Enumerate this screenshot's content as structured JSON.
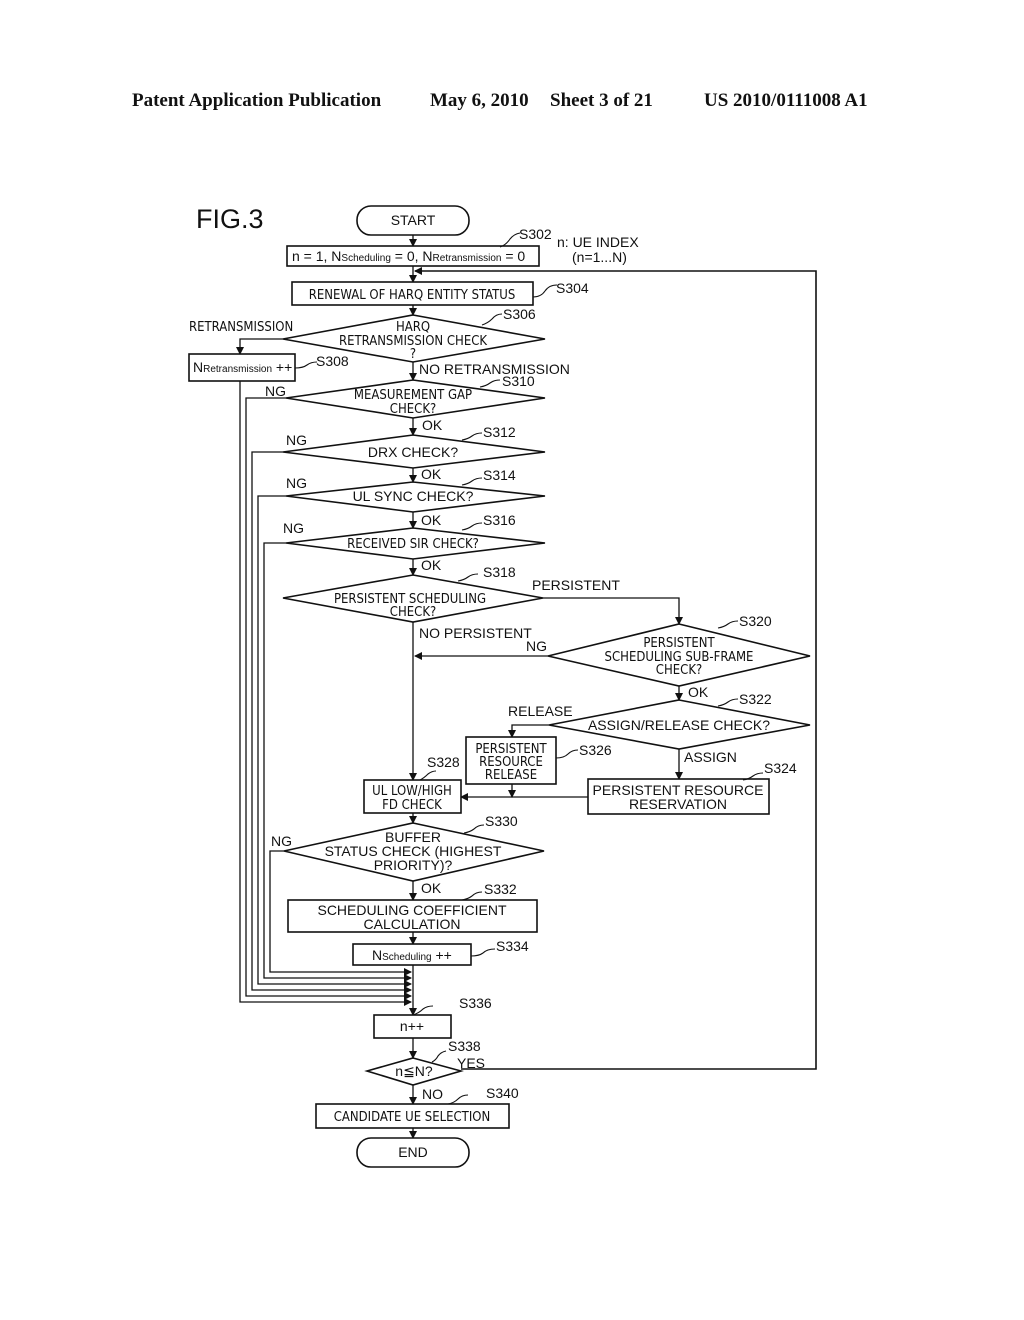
{
  "header": {
    "publication": "Patent Application Publication",
    "date": "May 6, 2010",
    "sheet": "Sheet 3 of 21",
    "number": "US 2010/0111008 A1"
  },
  "figure": {
    "title": "FIG.3",
    "note_line1": "n: UE INDEX",
    "note_line2": "(n=1...N)",
    "start": "START",
    "end": "END",
    "s302": {
      "id": "S302",
      "n": "n = 1, N",
      "sched_sub": "Scheduling",
      "eq0a": " = 0, N",
      "retx_sub": "Retransmission",
      "eq0b": " = 0"
    },
    "s304": {
      "id": "S304",
      "text": "RENEWAL OF HARQ ENTITY STATUS"
    },
    "s306": {
      "id": "S306",
      "line1": "HARQ",
      "line2": "RETRANSMISSION CHECK",
      "line3": "?",
      "left_label": "RETRANSMISSION",
      "down_label": "NO RETRANSMISSION"
    },
    "s308": {
      "id": "S308",
      "n": "N",
      "sub": "Retransmission",
      "op": " ++"
    },
    "s310": {
      "id": "S310",
      "line1": "MEASUREMENT GAP",
      "line2": "CHECK?",
      "ng": "NG",
      "ok": "OK"
    },
    "s312": {
      "id": "S312",
      "text": "DRX CHECK?",
      "ng": "NG",
      "ok": "OK"
    },
    "s314": {
      "id": "S314",
      "text": "UL SYNC CHECK?",
      "ng": "NG",
      "ok": "OK"
    },
    "s316": {
      "id": "S316",
      "text": "RECEIVED SIR CHECK?",
      "ng": "NG",
      "ok": "OK"
    },
    "s318": {
      "id": "S318",
      "line1": "PERSISTENT SCHEDULING",
      "line2": "CHECK?",
      "right_label": "PERSISTENT",
      "down_label": "NO PERSISTENT"
    },
    "s320": {
      "id": "S320",
      "line1": "PERSISTENT",
      "line2": "SCHEDULING SUB-FRAME",
      "line3": "CHECK?",
      "ng": "NG",
      "ok": "OK"
    },
    "s322": {
      "id": "S322",
      "text": "ASSIGN/RELEASE CHECK?",
      "left_label": "RELEASE",
      "down_label": "ASSIGN"
    },
    "s324": {
      "id": "S324",
      "line1": "PERSISTENT RESOURCE",
      "line2": "RESERVATION"
    },
    "s326": {
      "id": "S326",
      "line1": "PERSISTENT",
      "line2": "RESOURCE",
      "line3": "RELEASE"
    },
    "s328": {
      "id": "S328",
      "line1": "UL LOW/HIGH",
      "line2": "FD CHECK"
    },
    "s330": {
      "id": "S330",
      "line1": "BUFFER",
      "line2": "STATUS CHECK (HIGHEST",
      "line3": "PRIORITY)?",
      "ng": "NG",
      "ok": "OK"
    },
    "s332": {
      "id": "S332",
      "line1": "SCHEDULING COEFFICIENT",
      "line2": "CALCULATION"
    },
    "s334": {
      "id": "S334",
      "n": "N",
      "sub": "Scheduling",
      "op": " ++"
    },
    "s336": {
      "id": "S336",
      "text": "n++"
    },
    "s338": {
      "id": "S338",
      "text": "n≦N?",
      "yes": "YES",
      "no": "NO"
    },
    "s340": {
      "id": "S340",
      "text": "CANDIDATE UE SELECTION"
    }
  }
}
